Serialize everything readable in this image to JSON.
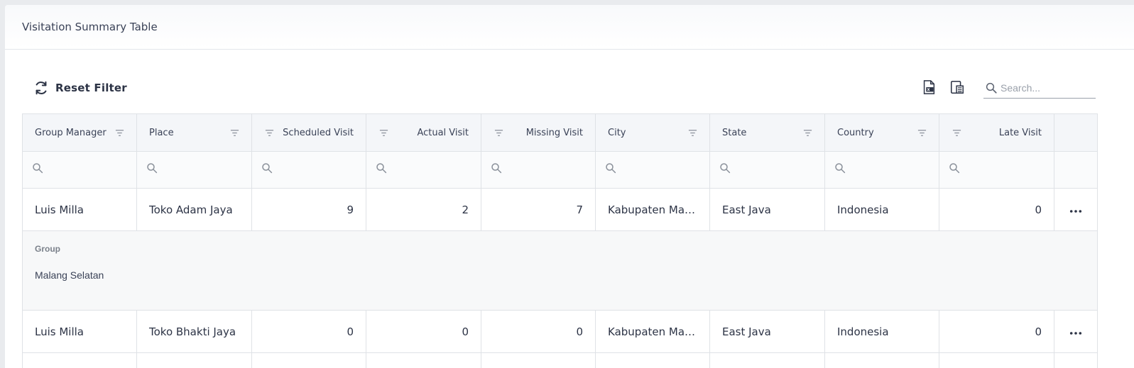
{
  "card": {
    "title": "Visitation Summary Table"
  },
  "toolbar": {
    "reset_label": "Reset Filter",
    "search_placeholder": "Search...",
    "icons": [
      "export-excel-icon",
      "column-chooser-icon",
      "search-icon"
    ]
  },
  "table": {
    "columns": [
      "Group Manager",
      "Place",
      "Scheduled Visit",
      "Actual Visit",
      "Missing Visit",
      "City",
      "State",
      "Country",
      "Late Visit"
    ],
    "rows": [
      {
        "group_manager": "Luis Milla",
        "place": "Toko Adam Jaya",
        "scheduled_visit": "9",
        "actual_visit": "2",
        "missing_visit": "7",
        "city": "Kabupaten Malang",
        "state": "East Java",
        "country": "Indonesia",
        "late_visit": "0",
        "detail": {
          "label": "Group",
          "value": "Malang Selatan"
        }
      },
      {
        "group_manager": "Luis Milla",
        "place": "Toko Bhakti Jaya",
        "scheduled_visit": "0",
        "actual_visit": "0",
        "missing_visit": "0",
        "city": "Kabupaten Malang",
        "state": "East Java",
        "country": "Indonesia",
        "late_visit": "0"
      }
    ]
  }
}
